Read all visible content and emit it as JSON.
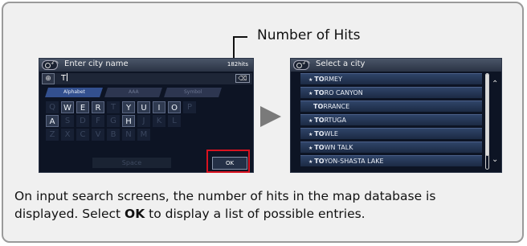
{
  "callout": {
    "label": "Number of Hits"
  },
  "screen1": {
    "title": "Enter city name",
    "hits": "182hits",
    "input_value": "T",
    "tabs": [
      "Alphabet",
      "AAA",
      "Symbol"
    ],
    "keyboard_rows": [
      [
        "Q",
        "W",
        "E",
        "R",
        "T",
        "Y",
        "U",
        "I",
        "O",
        "P"
      ],
      [
        "A",
        "S",
        "D",
        "F",
        "G",
        "H",
        "J",
        "K",
        "L"
      ],
      [
        "Z",
        "X",
        "C",
        "V",
        "B",
        "N",
        "M"
      ]
    ],
    "active_keys": [
      "W",
      "E",
      "R",
      "Y",
      "U",
      "I",
      "O",
      "A",
      "H"
    ],
    "space_label": "Space",
    "ok_label": "OK"
  },
  "screen2": {
    "title": "Select a city",
    "items": [
      {
        "prefix": "TO",
        "rest": "RMEY",
        "star": true
      },
      {
        "prefix": "TO",
        "rest": "RO CANYON",
        "star": true
      },
      {
        "prefix": "TO",
        "rest": "RRANCE",
        "star": false
      },
      {
        "prefix": "TO",
        "rest": "RTUGA",
        "star": true
      },
      {
        "prefix": "TO",
        "rest": "WLE",
        "star": true
      },
      {
        "prefix": "TO",
        "rest": "WN TALK",
        "star": true
      },
      {
        "prefix": "TO",
        "rest": "YON-SHASTA LAKE",
        "star": true
      }
    ]
  },
  "description": {
    "line1": "On input search screens, the number of hits in the map database is",
    "line2_before": "displayed. Select ",
    "line2_bold": "OK",
    "line2_after": " to display a list of possible entries."
  },
  "colors": {
    "highlight_frame": "#d8121f",
    "arrow": "#7a7a7a"
  },
  "icons": [
    "back-icon",
    "globe-icon",
    "delete-icon",
    "scroll-up-icon",
    "scroll-down-icon",
    "arrow-right-icon"
  ]
}
